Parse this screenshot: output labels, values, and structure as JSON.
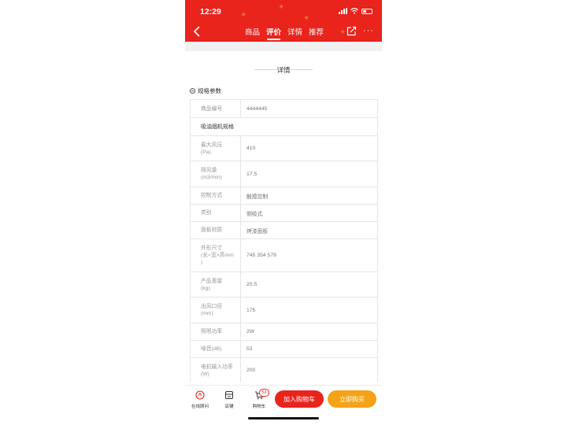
{
  "status": {
    "time": "12:29"
  },
  "header": {
    "tabs": [
      {
        "label": "商品",
        "active": false
      },
      {
        "label": "评价",
        "active": true
      },
      {
        "label": "详情",
        "active": false
      },
      {
        "label": "推荐",
        "active": false
      }
    ],
    "more_label": "···",
    "bg_color": "#e8241d"
  },
  "detail": {
    "title": "详情"
  },
  "spec": {
    "heading": "规格参数",
    "rows": [
      {
        "key": "商品编号",
        "value": "4444445"
      },
      {
        "section": "吸油烟机规格"
      },
      {
        "key": "最大风压\n(Pa)",
        "value": "410"
      },
      {
        "key": "排风量\n(m3/min)",
        "value": "17.5"
      },
      {
        "key": "控制方式",
        "value": "触摸控制"
      },
      {
        "key": "类别",
        "value": "侧吸式"
      },
      {
        "key": "面板材质",
        "value": "烤漆面板"
      },
      {
        "key": "外形尺寸\n(长×宽×高mm\n)",
        "value": "745 354 579"
      },
      {
        "key": "产品重量\n(kg)",
        "value": "20.5"
      },
      {
        "key": "出风口径\n(mm)",
        "value": "175"
      },
      {
        "key": "照明功率",
        "value": "2W"
      },
      {
        "key": "噪音(dB)",
        "value": "53"
      },
      {
        "key": "电机输入功率\n(W)",
        "value": "200"
      }
    ]
  },
  "bottom": {
    "service_label": "在线顾问",
    "store_label": "店铺",
    "cart_label": "购物车",
    "cart_count": "53",
    "add_cart_label": "加入购物车",
    "buy_label": "立即购买",
    "cart_color": "#e8241d",
    "buy_color": "#f4a318"
  }
}
